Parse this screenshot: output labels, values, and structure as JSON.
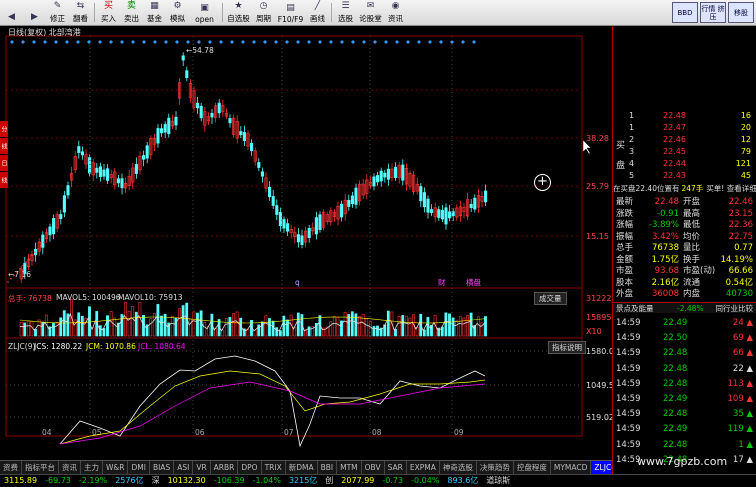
{
  "toolbar": {
    "buttons": [
      {
        "label": "",
        "icon": "back-icon"
      },
      {
        "label": "",
        "icon": "forward-icon"
      },
      {
        "label": "修正",
        "icon": "edit-icon"
      },
      {
        "label": "翻看",
        "icon": "flip-icon"
      },
      {
        "label": "买入",
        "icon": "buy-icon"
      },
      {
        "label": "卖出",
        "icon": "sell-icon"
      },
      {
        "label": "基金",
        "icon": "fund-icon"
      },
      {
        "label": "模拟",
        "icon": "simulate-icon"
      },
      {
        "label": "open",
        "icon": "open-icon"
      },
      {
        "label": "自选股",
        "icon": "watchlist-icon"
      },
      {
        "label": "周期",
        "icon": "period-icon"
      },
      {
        "label": "F10/F9",
        "icon": "f10-icon"
      },
      {
        "label": "画线",
        "icon": "draw-line-icon"
      },
      {
        "label": "选股",
        "icon": "stock-picker-icon"
      },
      {
        "label": "论股堂",
        "icon": "forum-icon"
      },
      {
        "label": "资讯",
        "icon": "news-icon"
      }
    ],
    "badges": [
      "BBD",
      "行情\n挤压",
      "移股\n"
    ]
  },
  "chart": {
    "title": "日线(复权) 北部湾港",
    "price_ticks": [
      "38.28",
      "25.79",
      "15.15"
    ],
    "high_label": "54.78",
    "low_label": "7.16",
    "date_labels": [
      "04",
      "05",
      "06",
      "07",
      "08",
      "09"
    ],
    "event_labels": [
      "q",
      "财",
      "横盘"
    ],
    "volume": {
      "label": "总手: 76738",
      "ma5": "MAVOL5: 100496",
      "ma10": "MAVOL10: 75913",
      "button": "成交量",
      "ticks": [
        "31222",
        "15895",
        "X10"
      ]
    },
    "zljc": {
      "label": "ZLJC(9)",
      "jcs": "JCS: 1280.22",
      "jcm": "JCM: 1070.86",
      "jcl": "JCL: 1080.64",
      "button": "指标说明",
      "ticks": [
        "1580.08",
        "1049.55",
        "519.02"
      ]
    }
  },
  "side_tabs": [
    "分",
    "线",
    "日",
    "线"
  ],
  "tabs": [
    "资费",
    "指标平台",
    "资讯",
    "主力",
    "W&R",
    "DMI",
    "BIAS",
    "ASI",
    "VR",
    "ARBR",
    "DPO",
    "TRIX",
    "新DMA",
    "BBI",
    "MTM",
    "OBV",
    "SAR",
    "EXPMA",
    "神奇选股",
    "决策趋势",
    "控盘程度",
    "MYMACD",
    "ZLJC(9)"
  ],
  "active_tab": "ZLJC(9)",
  "status": [
    {
      "text": "3115.89",
      "cls": "yl"
    },
    {
      "text": "-69.73",
      "cls": "dn"
    },
    {
      "text": "-2.19%",
      "cls": "dn"
    },
    {
      "text": "2576亿",
      "cls": "cy"
    },
    {
      "text": "深",
      "cls": "wh"
    },
    {
      "text": "10132.30",
      "cls": "yl"
    },
    {
      "text": "-106.39",
      "cls": "dn"
    },
    {
      "text": "-1.04%",
      "cls": "dn"
    },
    {
      "text": "3215亿",
      "cls": "cy"
    },
    {
      "text": "创",
      "cls": "wh"
    },
    {
      "text": "2077.99",
      "cls": "yl"
    },
    {
      "text": "-0.73",
      "cls": "dn"
    },
    {
      "text": "-0.04%",
      "cls": "dn"
    },
    {
      "text": "893.6亿",
      "cls": "cy"
    },
    {
      "text": "道琼斯",
      "cls": "wh"
    }
  ],
  "orderbook": {
    "side_labels": [
      "买",
      "盘"
    ],
    "rows": [
      {
        "level": "1",
        "price": "22.48",
        "vol": "16"
      },
      {
        "level": "1",
        "price": "22.47",
        "vol": "20"
      },
      {
        "level": "2",
        "price": "22.46",
        "vol": "12"
      },
      {
        "level": "3",
        "price": "22.45",
        "vol": "79"
      },
      {
        "level": "4",
        "price": "22.44",
        "vol": "121"
      },
      {
        "level": "5",
        "price": "22.43",
        "vol": "45"
      }
    ],
    "summary": "在买盘22.40位置有",
    "summary_vol": "247手",
    "summary_btn": "买单! 查看详细"
  },
  "quote": [
    {
      "l": "最新",
      "v": "22.48",
      "l2": "开盘",
      "v2": "22.46"
    },
    {
      "l": "涨跌",
      "v": "-0.91",
      "l2": "最高",
      "v2": "23.15"
    },
    {
      "l": "涨幅",
      "v": "-3.89%",
      "l2": "最低",
      "v2": "22.36"
    },
    {
      "l": "振幅",
      "v": "3.42%",
      "l2": "均价",
      "v2": "22.75"
    },
    {
      "l": "总手",
      "v": "76738",
      "l2": "量比",
      "v2": "0.77"
    },
    {
      "l": "金额",
      "v": "1.75亿",
      "l2": "换手",
      "v2": "14.19%"
    },
    {
      "l": "市盈",
      "v": "93.68",
      "l2": "市盈(动)",
      "v2": "66.66"
    },
    {
      "l": "股本",
      "v": "2.16亿",
      "l2": "流通",
      "v2": "0.54亿"
    },
    {
      "l": "外盘",
      "v": "36008",
      "l2": "内盘",
      "v2": "40730"
    }
  ],
  "ticks_header": {
    "left": "景点及能量",
    "mid": "-2.48%",
    "right": "同行业比较"
  },
  "ticks": [
    {
      "time": "14:59",
      "price": "22.49",
      "vol": "24"
    },
    {
      "time": "14:59",
      "price": "22.50",
      "vol": "69"
    },
    {
      "time": "14:59",
      "price": "22.48",
      "vol": "66"
    },
    {
      "time": "14:59",
      "price": "22.48",
      "vol": "22"
    },
    {
      "time": "14:59",
      "price": "22.48",
      "vol": "113"
    },
    {
      "time": "14:59",
      "price": "22.49",
      "vol": "109"
    },
    {
      "time": "14:59",
      "price": "22.48",
      "vol": "35"
    },
    {
      "time": "14:59",
      "price": "22.49",
      "vol": "119"
    },
    {
      "time": "14:59",
      "price": "22.48",
      "vol": "1"
    },
    {
      "time": "14:59",
      "price": "22.48",
      "vol": "17"
    }
  ],
  "watermark": "www.7gpzb.com"
}
